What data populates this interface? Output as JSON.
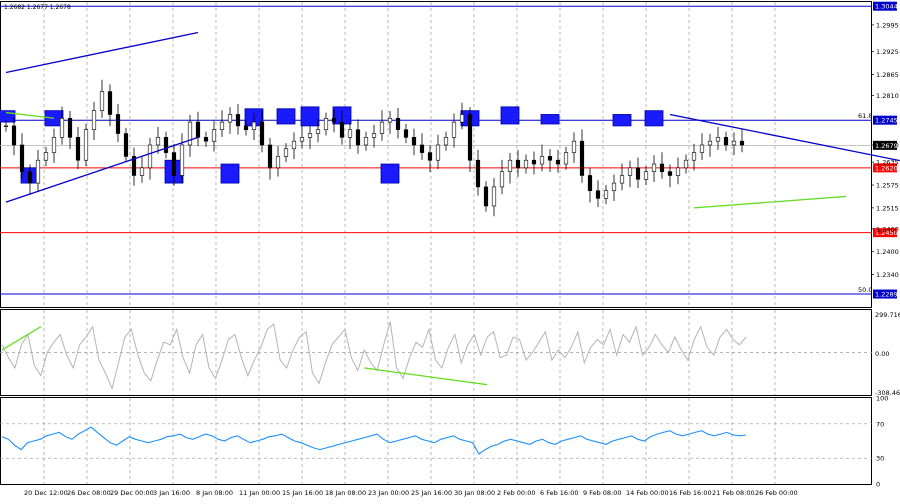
{
  "header": {
    "ohlc_text": "1.2682 1.2677 1.2678"
  },
  "chart_data": {
    "type": "candlestick",
    "time_labels": [
      "20 Dec 12:00",
      "26 Dec 08:00",
      "29 Dec 00:00",
      "3 Jan 16:00",
      "8 Jan 08:00",
      "11 Jan 00:00",
      "15 Jan 16:00",
      "18 Jan 08:00",
      "23 Jan 00:00",
      "25 Jan 16:00",
      "30 Jan 08:00",
      "2 Feb 00:00",
      "6 Feb 16:00",
      "9 Feb 08:00",
      "14 Feb 00:00",
      "16 Feb 16:00",
      "21 Feb 08:00",
      "26 Feb 00:00"
    ],
    "price_panel": {
      "ylim": [
        1.2255,
        1.3055
      ],
      "ticks": [
        "1.2995",
        "1.2925",
        "1.2865",
        "1.2810",
        "1.2680",
        "1.2635",
        "1.2575",
        "1.2515",
        "1.2460",
        "1.2400",
        "1.2340"
      ],
      "current_price": "1.2679",
      "levels": [
        {
          "value": 1.3044,
          "label": "1.3044",
          "color": "#0000cc",
          "tag": ""
        },
        {
          "value": 1.2745,
          "label": "1.2745",
          "color": "#0000cc",
          "tag": "61.8"
        },
        {
          "value": 1.262,
          "label": "1.2620",
          "color": "#ff0000",
          "tag": ""
        },
        {
          "value": 1.245,
          "label": "1.2450",
          "color": "#ff0000",
          "tag": ""
        },
        {
          "value": 1.2289,
          "label": "1.2289",
          "color": "#0000cc",
          "tag": "50.0"
        }
      ],
      "candles": [
        1.273,
        1.268,
        1.261,
        1.258,
        1.264,
        1.266,
        1.27,
        1.275,
        1.27,
        1.264,
        1.272,
        1.277,
        1.282,
        1.276,
        1.271,
        1.265,
        1.26,
        1.262,
        1.268,
        1.27,
        1.266,
        1.26,
        1.268,
        1.274,
        1.27,
        1.269,
        1.272,
        1.274,
        1.276,
        1.273,
        1.272,
        1.274,
        1.268,
        1.262,
        1.265,
        1.267,
        1.269,
        1.27,
        1.271,
        1.272,
        1.275,
        1.274,
        1.27,
        1.272,
        1.268,
        1.27,
        1.271,
        1.274,
        1.275,
        1.272,
        1.27,
        1.268,
        1.266,
        1.264,
        1.268,
        1.27,
        1.274,
        1.276,
        1.264,
        1.257,
        1.252,
        1.257,
        1.261,
        1.264,
        1.262,
        1.264,
        1.263,
        1.265,
        1.264,
        1.263,
        1.266,
        1.269,
        1.26,
        1.256,
        1.254,
        1.256,
        1.258,
        1.26,
        1.262,
        1.259,
        1.261,
        1.263,
        1.261,
        1.26,
        1.262,
        1.264,
        1.266,
        1.268,
        1.269,
        1.27,
        1.268,
        1.269,
        1.268
      ],
      "trendlines": [
        {
          "color": "#0000cc",
          "points": [
            [
              0,
              1.287
            ],
            [
              24,
              1.2975
            ]
          ]
        },
        {
          "color": "#0000cc",
          "points": [
            [
              0,
              1.253
            ],
            [
              24,
              1.27
            ]
          ]
        },
        {
          "color": "#0000cc",
          "points": [
            [
              83,
              1.276
            ],
            [
              121,
              1.26
            ]
          ]
        },
        {
          "color": "#66dd22",
          "points": [
            [
              86,
              1.2515
            ],
            [
              105,
              1.2545
            ]
          ]
        },
        {
          "color": "#66dd22",
          "points": [
            [
              0,
              1.2765
            ],
            [
              6,
              1.275
            ]
          ]
        }
      ],
      "markers": [
        {
          "index": 0,
          "top": 1.277,
          "bottom": 1.274
        },
        {
          "index": 3,
          "top": 1.262,
          "bottom": 1.258
        },
        {
          "index": 6,
          "top": 1.277,
          "bottom": 1.273
        },
        {
          "index": 21,
          "top": 1.264,
          "bottom": 1.258
        },
        {
          "index": 28,
          "top": 1.263,
          "bottom": 1.258
        },
        {
          "index": 31,
          "top": 1.2775,
          "bottom": 1.273
        },
        {
          "index": 35,
          "top": 1.2775,
          "bottom": 1.2735
        },
        {
          "index": 38,
          "top": 1.278,
          "bottom": 1.273
        },
        {
          "index": 42,
          "top": 1.278,
          "bottom": 1.2735
        },
        {
          "index": 48,
          "top": 1.263,
          "bottom": 1.258
        },
        {
          "index": 58,
          "top": 1.277,
          "bottom": 1.273
        },
        {
          "index": 63,
          "top": 1.278,
          "bottom": 1.2735
        },
        {
          "index": 68,
          "top": 1.276,
          "bottom": 1.2735
        },
        {
          "index": 77,
          "top": 1.276,
          "bottom": 1.273
        },
        {
          "index": 81,
          "top": 1.277,
          "bottom": 1.273
        }
      ]
    },
    "cci_panel": {
      "ylim": [
        -330,
        330
      ],
      "max_label": "299.7167",
      "zero_label": "0.00",
      "min_label": "-308.465",
      "values": [
        60,
        -40,
        -120,
        60,
        140,
        -100,
        -180,
        0,
        80,
        140,
        -20,
        -120,
        60,
        120,
        200,
        -60,
        -160,
        -280,
        -80,
        120,
        180,
        -20,
        -160,
        -220,
        -60,
        80,
        60,
        180,
        -40,
        -160,
        60,
        140,
        -120,
        -200,
        -60,
        100,
        140,
        -40,
        -180,
        -60,
        40,
        180,
        220,
        -60,
        -120,
        20,
        120,
        160,
        -160,
        -240,
        -80,
        60,
        120,
        180,
        -40,
        -140,
        20,
        -80,
        -140,
        60,
        240,
        -120,
        -200,
        -40,
        80,
        40,
        180,
        -60,
        -120,
        40,
        140,
        -80,
        60,
        140,
        -20,
        120,
        160,
        -40,
        -20,
        120,
        100,
        -60,
        0,
        80,
        160,
        -60,
        20,
        -40,
        40,
        160,
        -80,
        40,
        100,
        60,
        180,
        -20,
        140,
        80,
        200,
        -20,
        40,
        140,
        60,
        0,
        120,
        20,
        -60,
        100,
        200,
        40,
        -20,
        120,
        180,
        100,
        60,
        120
      ],
      "divergence_lines": [
        {
          "color": "#66dd22",
          "points": [
            [
              0,
              20
            ],
            [
              6,
              200
            ]
          ]
        },
        {
          "color": "#66dd22",
          "points": [
            [
              56,
              -120
            ],
            [
              75,
              -250
            ]
          ]
        }
      ]
    },
    "rsi_panel": {
      "ylim": [
        0,
        100
      ],
      "labels": [
        "100",
        "70",
        "30",
        "0"
      ],
      "values": [
        55,
        52,
        45,
        40,
        48,
        50,
        52,
        56,
        58,
        60,
        55,
        52,
        58,
        62,
        66,
        60,
        54,
        48,
        45,
        50,
        55,
        52,
        50,
        48,
        50,
        52,
        55,
        56,
        58,
        54,
        52,
        55,
        58,
        56,
        52,
        50,
        54,
        56,
        52,
        48,
        50,
        52,
        55,
        56,
        58,
        54,
        50,
        48,
        45,
        42,
        40,
        42,
        44,
        46,
        48,
        50,
        52,
        54,
        56,
        58,
        52,
        48,
        50,
        52,
        54,
        56,
        52,
        50,
        48,
        52,
        54,
        56,
        52,
        50,
        48,
        35,
        40,
        44,
        46,
        50,
        52,
        50,
        48,
        46,
        50,
        52,
        48,
        46,
        50,
        52,
        54,
        56,
        52,
        50,
        48,
        46,
        50,
        52,
        54,
        56,
        52,
        50,
        55,
        58,
        60,
        62,
        58,
        56,
        58,
        60,
        62,
        58,
        56,
        58,
        60,
        57,
        56,
        57
      ]
    }
  }
}
